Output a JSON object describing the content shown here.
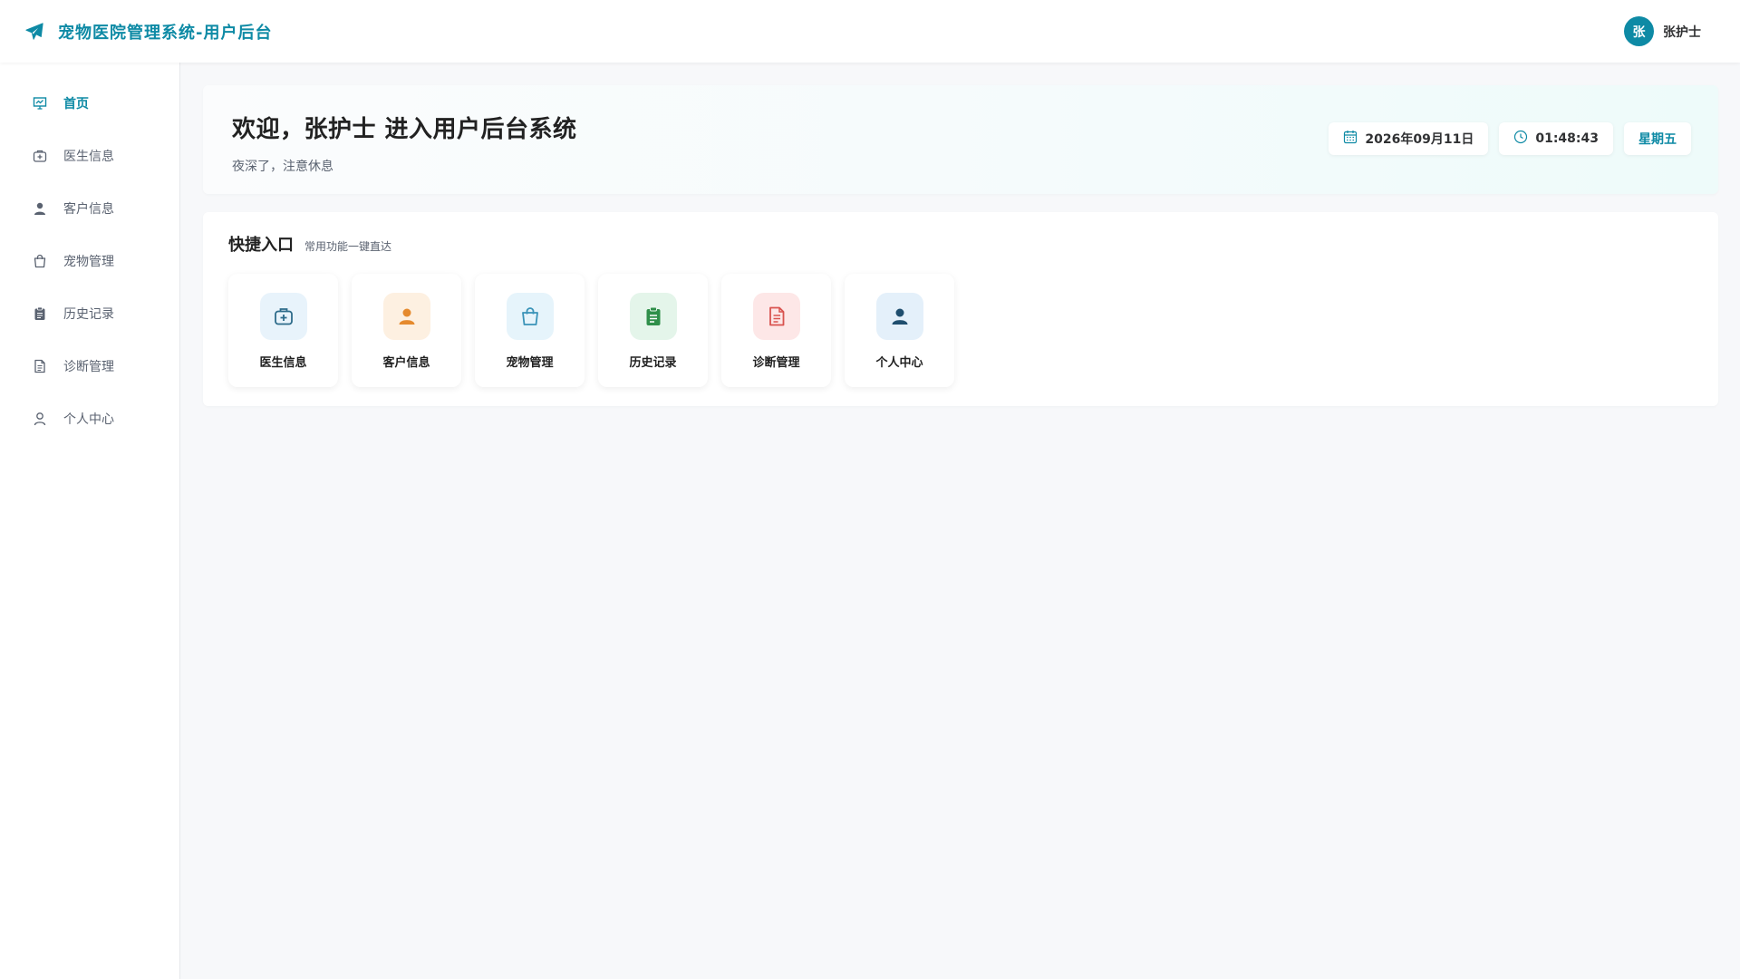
{
  "header": {
    "brand_icon": "paper-plane-icon",
    "title": "宠物医院管理系统-用户后台",
    "user": {
      "avatar_text": "张",
      "name": "张护士"
    }
  },
  "sidebar": {
    "items": [
      {
        "label": "首页",
        "icon": "presentation-chart-icon",
        "active": true
      },
      {
        "label": "医生信息",
        "icon": "medical-kit-icon",
        "active": false
      },
      {
        "label": "客户信息",
        "icon": "user-icon",
        "active": false
      },
      {
        "label": "宠物管理",
        "icon": "shopping-bag-icon",
        "active": false
      },
      {
        "label": "历史记录",
        "icon": "clipboard-icon",
        "active": false
      },
      {
        "label": "诊断管理",
        "icon": "document-icon",
        "active": false
      },
      {
        "label": "个人中心",
        "icon": "user-outline-icon",
        "active": false
      }
    ]
  },
  "welcome": {
    "title": "欢迎，张护士 进入用户后台系统",
    "subtitle": "夜深了，注意休息",
    "date": "2026年09月11日",
    "time": "01:48:43",
    "weekday": "星期五"
  },
  "quick": {
    "title": "快捷入口",
    "subtitle": "常用功能一键直达",
    "tiles": [
      {
        "label": "医生信息",
        "icon": "medical-kit-icon",
        "bg": "#e8f3fb",
        "color": "#2d6b8a"
      },
      {
        "label": "客户信息",
        "icon": "user-icon",
        "bg": "#fdf0e1",
        "color": "#e58a2e"
      },
      {
        "label": "宠物管理",
        "icon": "shopping-bag-icon",
        "bg": "#e6f4fb",
        "color": "#3a93b8"
      },
      {
        "label": "历史记录",
        "icon": "clipboard-icon",
        "bg": "#e4f5ea",
        "color": "#2f8f4a"
      },
      {
        "label": "诊断管理",
        "icon": "document-icon",
        "bg": "#fde7e7",
        "color": "#d9534f"
      },
      {
        "label": "个人中心",
        "icon": "user-icon",
        "bg": "#e4f0fa",
        "color": "#1f4e6e"
      }
    ]
  },
  "colors": {
    "accent": "#0e8aa5",
    "background": "#f7f8fa",
    "text": "#303133",
    "muted": "#5a6270"
  }
}
